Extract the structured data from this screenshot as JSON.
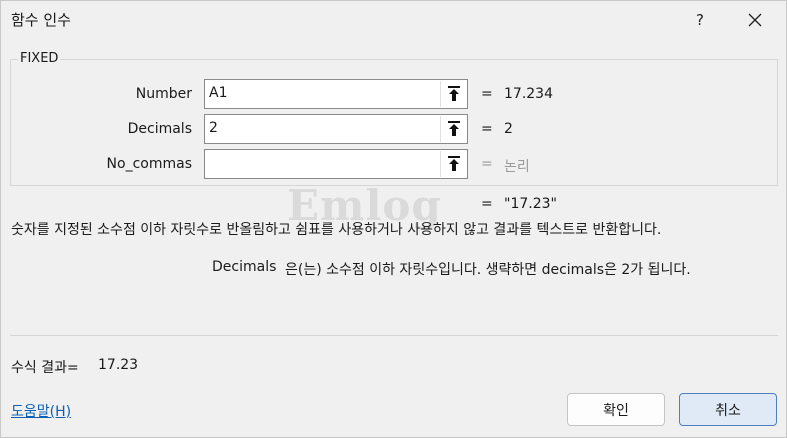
{
  "window": {
    "title": "함수 인수",
    "help_glyph": "?",
    "close_icon": "close-icon"
  },
  "function": {
    "name": "FIXED",
    "args": [
      {
        "label": "Number",
        "value": "A1",
        "equals": "=",
        "result": "17.234",
        "result_muted": false
      },
      {
        "label": "Decimals",
        "value": "2",
        "equals": "=",
        "result": "2",
        "result_muted": false
      },
      {
        "label": "No_commas",
        "value": "",
        "equals": "=",
        "result": "논리",
        "result_muted": true
      }
    ],
    "overall_equals": "=",
    "overall_result": "\"17.23\"",
    "description": "숫자를 지정된 소수점 이하 자릿수로 반올림하고 쉼표를 사용하거나 사용하지 않고 결과를 텍스트로 반환합니다.",
    "arg_desc_name": "Decimals",
    "arg_desc_text": "은(는) 소수점 이하 자릿수입니다. 생략하면 decimals은 2가 됩니다."
  },
  "watermark": "Emlog",
  "footer": {
    "formula_result_label": "수식 결과=",
    "formula_result_value": "17.23",
    "help_link": "도움말(H)",
    "ok_label": "확인",
    "cancel_label": "취소"
  },
  "colors": {
    "window_bg": "#f0f0f0",
    "link": "#0a5fb4",
    "muted": "#9a9a9a",
    "cancel_focus_border": "#4f7fbd"
  }
}
